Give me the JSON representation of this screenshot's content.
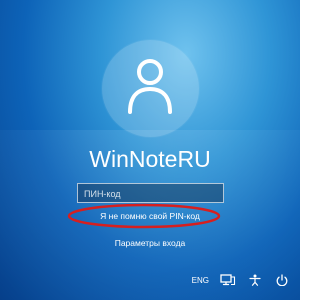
{
  "user": {
    "avatar_icon": "user-icon",
    "name": "WinNoteRU"
  },
  "signin": {
    "pin_placeholder": "ПИН-код",
    "forgot_pin_link": "Я не помню свой PIN-код",
    "options_link": "Параметры входа"
  },
  "tray": {
    "language": "ENG",
    "network_icon": "network-icon",
    "accessibility_icon": "ease-of-access-icon",
    "power_icon": "power-icon"
  },
  "annotations": {
    "highlight_color": "#d61f1f"
  },
  "theme": {
    "background_top": "#6fc2ee",
    "background_bottom": "#063f8a"
  }
}
